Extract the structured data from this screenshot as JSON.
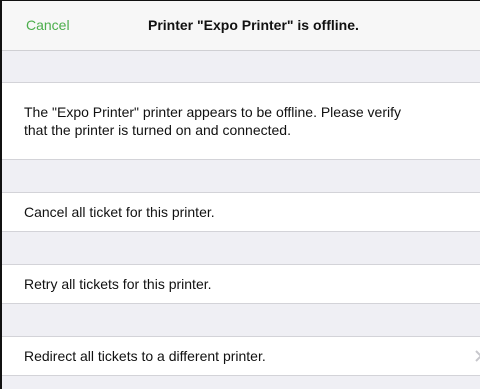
{
  "navbar": {
    "cancel_label": "Cancel",
    "title": "Printer \"Expo Printer\" is offline."
  },
  "message": {
    "line1": "The \"Expo Printer\" printer appears to be offline. Please verify",
    "line2": "that the printer is turned on and connected."
  },
  "actions": [
    {
      "label": "Cancel all ticket for this printer."
    },
    {
      "label": "Retry all tickets for this printer."
    },
    {
      "label": "Redirect all tickets to a different printer.",
      "icon": "chevron-right-icon"
    }
  ],
  "colors": {
    "accent": "#4cae4c",
    "background": "#efeff4",
    "cell": "#ffffff",
    "separator": "#d3d3d8"
  }
}
